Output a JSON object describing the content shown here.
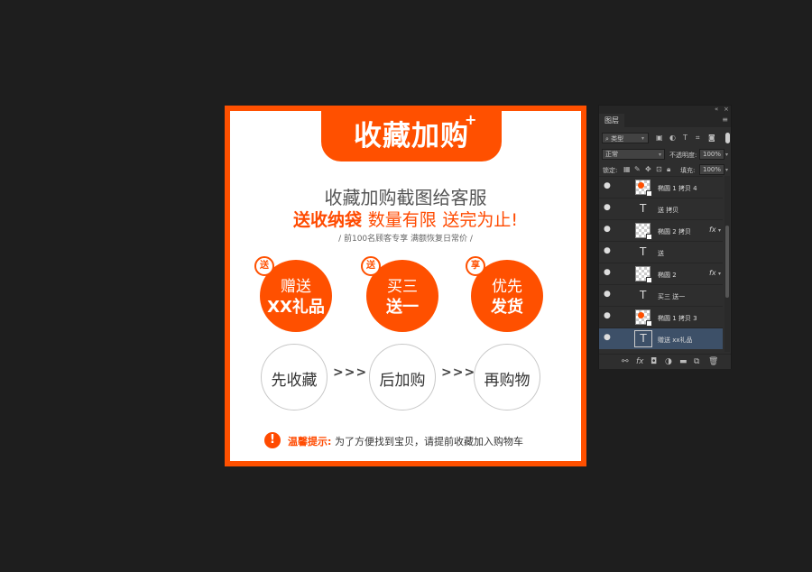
{
  "artboard": {
    "tab_title": "收藏加购",
    "tab_plus": "+",
    "headline1": "收藏加购截图给客服",
    "headline2_bold": "送收纳袋",
    "headline2_thin": "数量有限",
    "headline2_end": "送完为止!",
    "subline": "/ 前100名顾客专享  满额恢复日常价 /",
    "benefits": [
      {
        "badge": "送",
        "line1": "赠送",
        "line2": "XX礼品"
      },
      {
        "badge": "送",
        "line1": "买三",
        "line2": "送一"
      },
      {
        "badge": "享",
        "line1": "优先",
        "line2": "发货"
      }
    ],
    "steps": [
      "先收藏",
      "后加购",
      "再购物"
    ],
    "arrow": ">>>",
    "tip_icon": "!",
    "tip_label": "温馨提示:",
    "tip_text": "为了方便找到宝贝，请提前收藏加入购物车",
    "accent_color": "#ff5000"
  },
  "panel": {
    "tab": "图层",
    "filter": "类型",
    "blend_mode": "正常",
    "opacity_label": "不透明度:",
    "opacity": "100%",
    "lock_label": "锁定:",
    "fill_label": "填充:",
    "fill": "100%",
    "layers": [
      {
        "name": "椭圆 1 拷贝 4",
        "kind": "shape",
        "fx": false
      },
      {
        "name": "送 拷贝",
        "kind": "text",
        "fx": false
      },
      {
        "name": "椭圆 2 拷贝",
        "kind": "shape",
        "fx": true
      },
      {
        "name": "送",
        "kind": "text",
        "fx": false
      },
      {
        "name": "椭圆 2",
        "kind": "shape",
        "fx": true
      },
      {
        "name": "买三 送一",
        "kind": "text",
        "fx": false
      },
      {
        "name": "椭圆 1 拷贝 3",
        "kind": "shape",
        "fx": false
      },
      {
        "name": "赠送 xx礼品",
        "kind": "text",
        "fx": false,
        "selected": true
      }
    ],
    "fx_label": "fx"
  }
}
